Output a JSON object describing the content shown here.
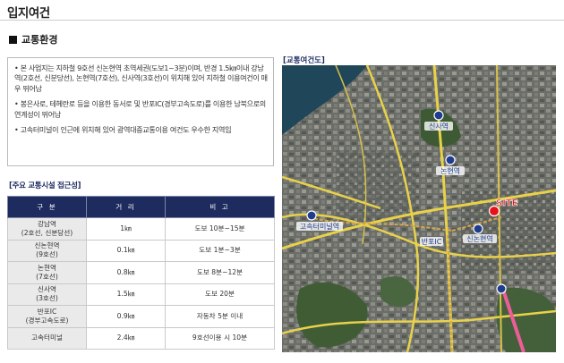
{
  "page_title": "입지여건",
  "section_title": "교통환경",
  "bullets": [
    "• 본 사업지는 지하철 9호선 신논현역 초역세권(도보1~3분)이며, 반경 1.5㎞이내 강남역(2호선, 신분당선), 논현역(7호선), 신사역(3호선)이 위치해 있어 지하철 이용여건이 매우 뛰어남",
    "• 봉은사로, 테헤란로 등을 이용한 동서로 및 반포IC(경부고속도로)를 이용한 남북으로의 연계성이 뛰어남",
    "• 고속터미널이 인근에 위치해 있어 광역대중교통이용 여건도 우수한 지역임"
  ],
  "table": {
    "caption": "[주요 교통시설 접근성]",
    "headers": [
      "구 분",
      "거 리",
      "비 고"
    ],
    "rows": [
      {
        "name": "강남역\n(2호선, 신분당선)",
        "distance": "1㎞",
        "note": "도보 10분~15분"
      },
      {
        "name": "신논현역\n(9호선)",
        "distance": "0.1㎞",
        "note": "도보 1분~3분"
      },
      {
        "name": "논현역\n(7호선)",
        "distance": "0.8㎞",
        "note": "도보 8분~12분"
      },
      {
        "name": "신사역\n(3호선)",
        "distance": "1.5㎞",
        "note": "도보 20분"
      },
      {
        "name": "반포IC\n(경부고속도로)",
        "distance": "0.9㎞",
        "note": "자동차 5분 이내"
      },
      {
        "name": "고속터미널",
        "distance": "2.4㎞",
        "note": "9호선이용 시 10분"
      }
    ]
  },
  "map": {
    "caption": "[교통여건도]",
    "site_label": "SITE",
    "labels": {
      "sinsa": "신사역",
      "nonhyeon": "논현역",
      "express_bus": "고속터미널역",
      "banpo_ic": "반포IC",
      "sinnonhyeon": "신논현역"
    },
    "colors": {
      "site_marker": "#e8101b",
      "road": "#e9d24a",
      "line9": "#d4a64a",
      "line7": "#ee5c9a",
      "station": "#1f3d8f"
    }
  }
}
